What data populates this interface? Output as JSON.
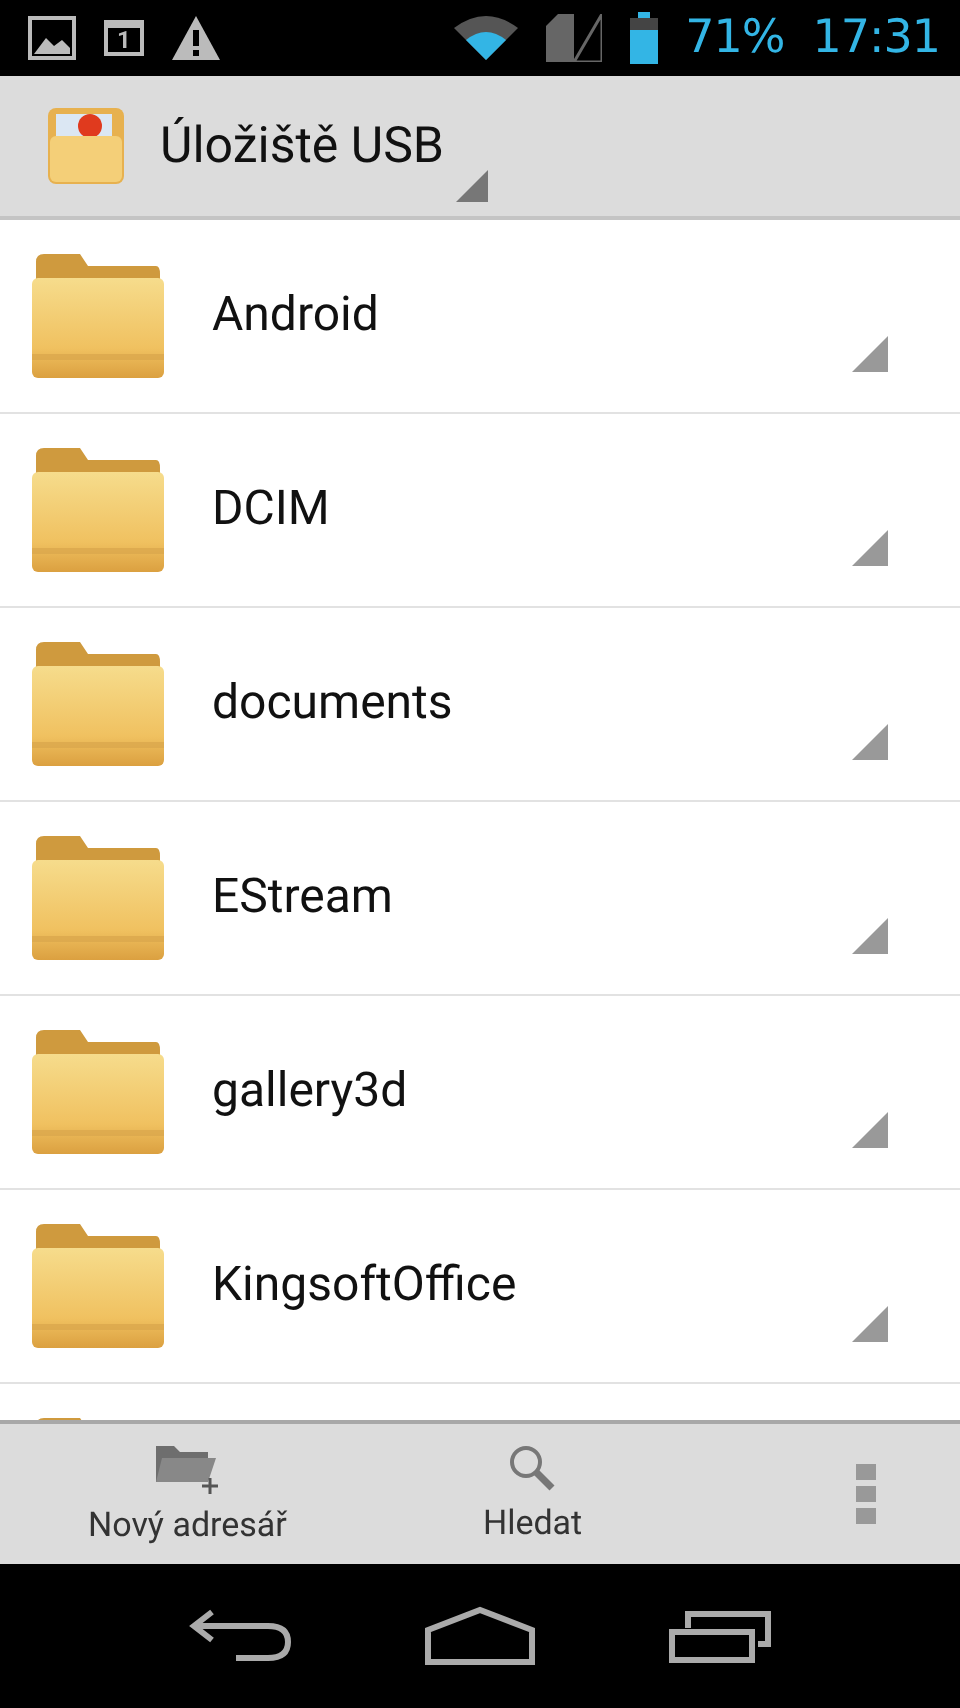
{
  "status_bar": {
    "calendar_day": "1",
    "battery": "71%",
    "time": "17:31"
  },
  "action_bar": {
    "title": "Úložiště USB"
  },
  "folders": [
    {
      "name": "Android"
    },
    {
      "name": "DCIM"
    },
    {
      "name": "documents"
    },
    {
      "name": "EStream"
    },
    {
      "name": "gallery3d"
    },
    {
      "name": "KingsoftOffice"
    }
  ],
  "bottom_actions": [
    {
      "kind": "new_folder",
      "label": "Nový adresář"
    },
    {
      "kind": "search",
      "label": "Hledat"
    }
  ]
}
